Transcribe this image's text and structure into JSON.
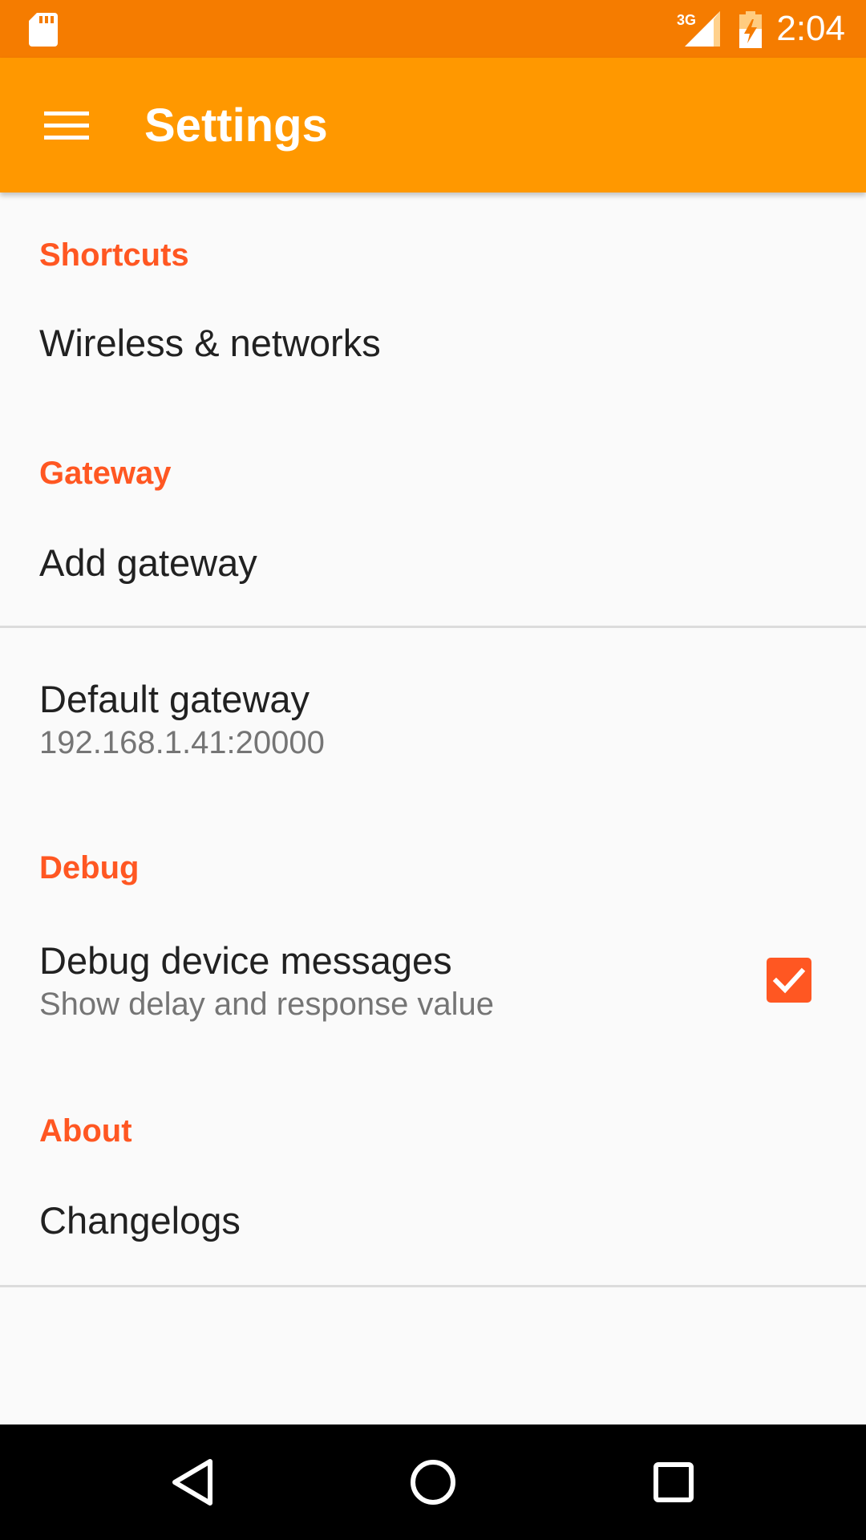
{
  "status_bar": {
    "time": "2:04",
    "network_type": "3G",
    "icons": [
      "sd-card-icon",
      "signal-3g-icon",
      "battery-charging-icon"
    ]
  },
  "app_bar": {
    "title": "Settings",
    "menu_icon": "menu-icon"
  },
  "sections": {
    "shortcuts": {
      "header": "Shortcuts",
      "items": [
        "Wireless & networks"
      ]
    },
    "gateway": {
      "header": "Gateway",
      "add_title": "Add gateway",
      "default_title": "Default gateway",
      "default_summary": "192.168.1.41:20000"
    },
    "debug": {
      "header": "Debug",
      "title": "Debug device messages",
      "summary": "Show delay and response value",
      "checked": true
    },
    "about": {
      "header": "About",
      "changelogs": "Changelogs"
    }
  },
  "nav_bar": {
    "icons": [
      "back-icon",
      "home-icon",
      "recents-icon"
    ]
  },
  "colors": {
    "status_bar": "#f57c00",
    "app_bar": "#ff9800",
    "accent": "#ff5722",
    "background": "#fafafa",
    "text_primary": "#212121",
    "text_secondary": "#757575"
  }
}
